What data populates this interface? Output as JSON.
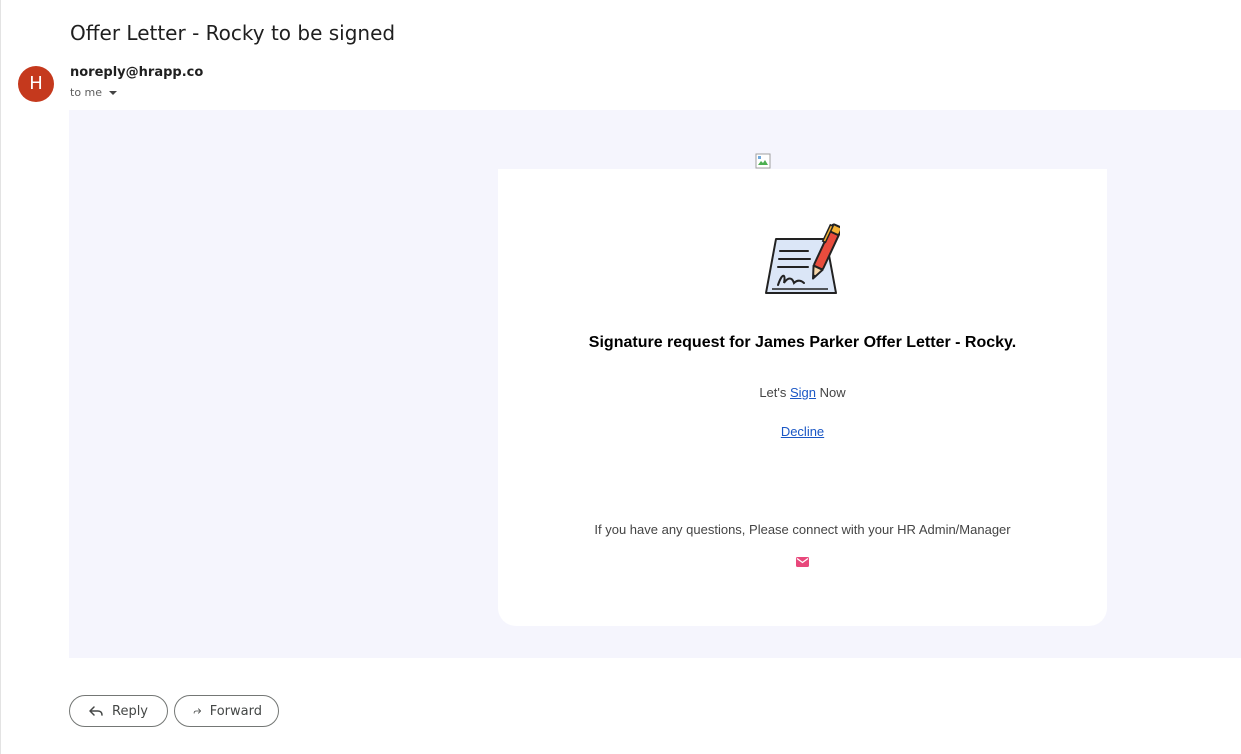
{
  "email": {
    "subject": "Offer Letter - Rocky to be signed",
    "avatar_letter": "H",
    "avatar_color": "#c5391d",
    "sender": "noreply@hrapp.co",
    "recipient": "to me"
  },
  "card": {
    "title": "Signature request for James Parker Offer Letter - Rocky.",
    "sign_prefix": "Let's",
    "sign_link": "Sign",
    "sign_suffix": "Now",
    "decline_link": "Decline",
    "questions_text": "If you have any questions, Please connect with your HR Admin/Manager",
    "icons": [
      "signing-document-icon",
      "mail-icon",
      "broken-image-icon"
    ]
  },
  "actions": {
    "reply_label": "Reply",
    "forward_label": "Forward"
  },
  "colors": {
    "body_background": "#f5f5fd",
    "link": "#1a57c5",
    "mail_icon": "#e8487b"
  }
}
